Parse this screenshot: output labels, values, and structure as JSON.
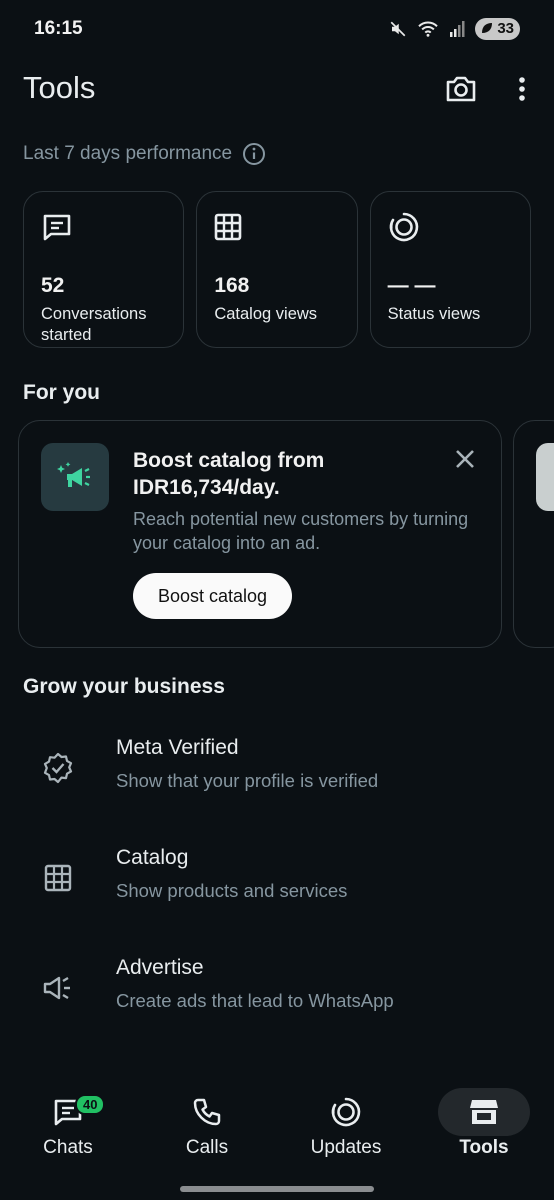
{
  "status_bar": {
    "time": "16:15",
    "battery": "33"
  },
  "header": {
    "title": "Tools"
  },
  "performance": {
    "label": "Last 7 days performance",
    "stats": [
      {
        "value": "52",
        "label": "Conversations started",
        "icon": "message-icon"
      },
      {
        "value": "168",
        "label": "Catalog views",
        "icon": "catalog-grid-icon"
      },
      {
        "value": "— —",
        "label": "Status views",
        "icon": "status-icon"
      }
    ]
  },
  "for_you": {
    "title": "For you",
    "card": {
      "title": "Boost catalog from IDR16,734/day.",
      "description": "Reach potential new customers by turning your catalog into an ad.",
      "button": "Boost catalog"
    }
  },
  "grow": {
    "title": "Grow your business",
    "items": [
      {
        "title": "Meta Verified",
        "subtitle": "Show that your profile is verified",
        "icon": "verified-badge-icon"
      },
      {
        "title": "Catalog",
        "subtitle": "Show products and services",
        "icon": "catalog-grid-icon"
      },
      {
        "title": "Advertise",
        "subtitle": "Create ads that lead to WhatsApp",
        "icon": "megaphone-icon"
      }
    ]
  },
  "nav": {
    "chats": "Chats",
    "chats_badge": "40",
    "calls": "Calls",
    "updates": "Updates",
    "tools": "Tools"
  },
  "colors": {
    "background": "#0b1014",
    "accent": "#21c063",
    "muted_text": "#8696a0"
  }
}
